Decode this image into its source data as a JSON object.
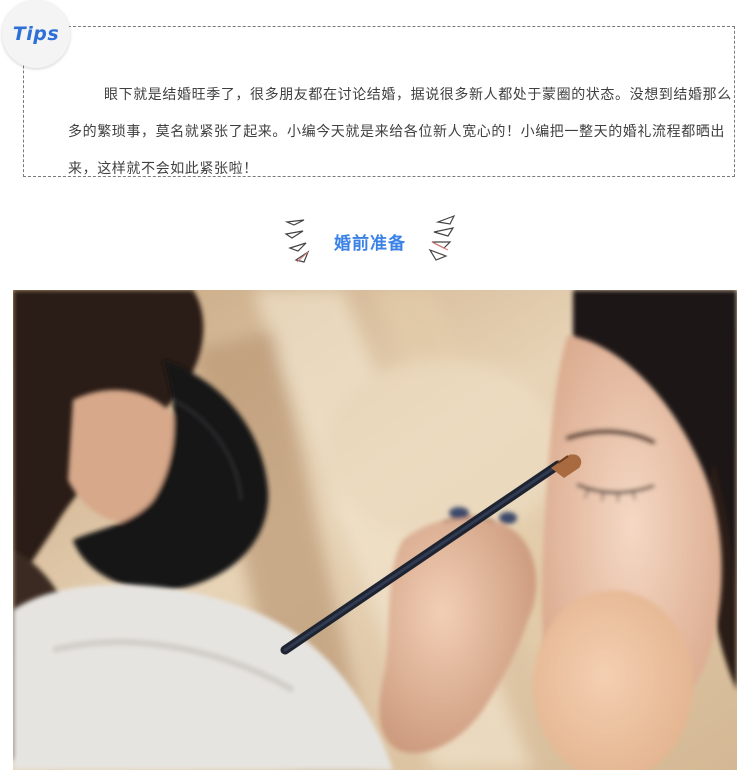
{
  "tips": {
    "badge_label": "Tips",
    "paragraph": "眼下就是结婚旺季了，很多朋友都在讨论结婚，据说很多新人都处于蒙圈的状态。没想到结婚那么多的繁琐事，莫名就紧张了起来。小编今天就是来给各位新人宽心的！小编把一整天的婚礼流程都晒出来，这样就不会如此紧张啦！"
  },
  "section": {
    "title": "婚前准备"
  },
  "photo": {
    "subject": "makeup artist applying eyebrow makeup to bride"
  },
  "colors": {
    "accent_blue": "#3b82e6",
    "badge_blue": "#2f6fd8",
    "body_text": "#404040",
    "dashed_border": "#7a7a7a"
  }
}
